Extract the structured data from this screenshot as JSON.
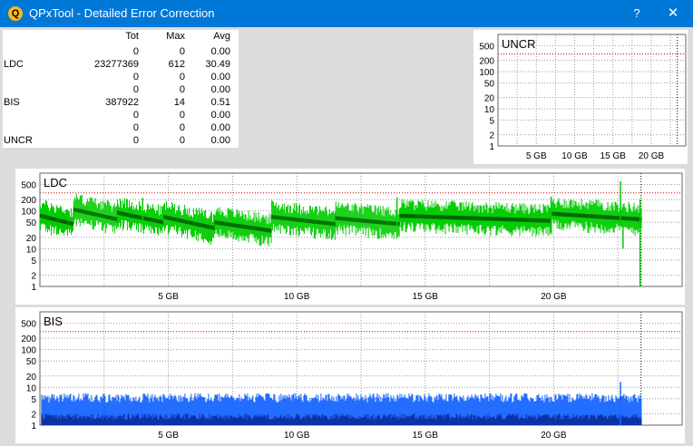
{
  "window": {
    "title": "QPxTool - Detailed Error Correction",
    "help_label": "?",
    "close_label": "✕",
    "app_icon_glyph": "Q"
  },
  "stats": {
    "headers": [
      "Tot",
      "Max",
      "Avg"
    ],
    "rows": [
      {
        "label": "",
        "tot": "0",
        "max": "0",
        "avg": "0.00"
      },
      {
        "label": "LDC",
        "tot": "23277369",
        "max": "612",
        "avg": "30.49"
      },
      {
        "label": "",
        "tot": "0",
        "max": "0",
        "avg": "0.00"
      },
      {
        "label": "",
        "tot": "0",
        "max": "0",
        "avg": "0.00"
      },
      {
        "label": "BIS",
        "tot": "387922",
        "max": "14",
        "avg": "0.51"
      },
      {
        "label": "",
        "tot": "0",
        "max": "0",
        "avg": "0.00"
      },
      {
        "label": "",
        "tot": "0",
        "max": "0",
        "avg": "0.00"
      },
      {
        "label": "UNCR",
        "tot": "0",
        "max": "0",
        "avg": "0.00"
      }
    ]
  },
  "chart_data": [
    {
      "type": "bar",
      "title": "UNCR",
      "y_scale": "log",
      "y_ticks": [
        "1",
        "2",
        "5",
        "10",
        "20",
        "50",
        "100",
        "200",
        "500"
      ],
      "x_ticks": [
        "5 GB",
        "10 GB",
        "15 GB",
        "20 GB"
      ],
      "x_range_gb": [
        0,
        24.5
      ],
      "red_line_value": 300,
      "disc_end_gb": 23.4,
      "values": []
    },
    {
      "type": "area",
      "title": "LDC",
      "y_scale": "log",
      "y_ticks": [
        "1",
        "2",
        "5",
        "10",
        "20",
        "50",
        "100",
        "200",
        "500"
      ],
      "x_ticks": [
        "5 GB",
        "10 GB",
        "15 GB",
        "20 GB"
      ],
      "x_range_gb": [
        0,
        25.0
      ],
      "red_line_value": 300,
      "disc_end_gb": 23.4,
      "colors": {
        "peak": "#00cc00",
        "avg": "#006400"
      },
      "segments": [
        {
          "x_start": 0.0,
          "x_end": 1.3,
          "avg_start": 75,
          "avg_end": 45
        },
        {
          "x_start": 1.3,
          "x_end": 3.0,
          "avg_start": 110,
          "avg_end": 60
        },
        {
          "x_start": 3.0,
          "x_end": 4.8,
          "avg_start": 90,
          "avg_end": 50
        },
        {
          "x_start": 4.8,
          "x_end": 6.8,
          "avg_start": 70,
          "avg_end": 35
        },
        {
          "x_start": 6.8,
          "x_end": 9.0,
          "avg_start": 50,
          "avg_end": 30
        },
        {
          "x_start": 9.0,
          "x_end": 11.5,
          "avg_start": 70,
          "avg_end": 45
        },
        {
          "x_start": 11.5,
          "x_end": 14.0,
          "avg_start": 65,
          "avg_end": 45
        },
        {
          "x_start": 14.0,
          "x_end": 19.9,
          "avg_start": 75,
          "avg_end": 55
        },
        {
          "x_start": 19.9,
          "x_end": 23.4,
          "avg_start": 85,
          "avg_end": 60
        }
      ],
      "peak_max": 612
    },
    {
      "type": "bar",
      "title": "BIS",
      "y_scale": "log",
      "y_ticks": [
        "1",
        "2",
        "5",
        "10",
        "20",
        "50",
        "100",
        "200",
        "500"
      ],
      "x_ticks": [
        "5 GB",
        "10 GB",
        "15 GB",
        "20 GB"
      ],
      "x_range_gb": [
        0,
        25.0
      ],
      "red_line_value": 300,
      "disc_end_gb": 23.4,
      "colors": {
        "peak": "#1464ff",
        "avg": "#0a2a9a"
      },
      "typical_peak": 5,
      "typical_avg": 1,
      "peak_max": 14
    }
  ]
}
